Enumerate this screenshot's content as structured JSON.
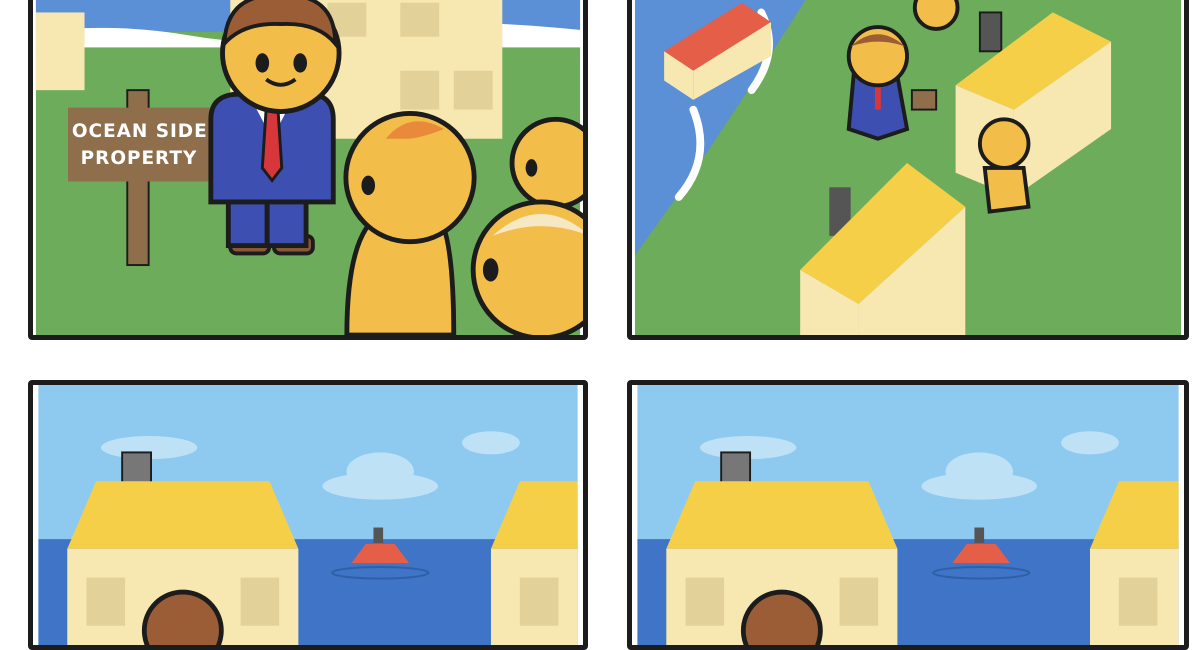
{
  "comic": {
    "sign": {
      "line1": "OCEAN SIDE",
      "line2": "PROPERTY"
    }
  },
  "colors": {
    "outline": "#1c1c1c",
    "sky": "#8ec9ef",
    "ocean": "#3f74c6",
    "grass": "#6cac5a",
    "skin": "#f3bd4a",
    "roof": "#f6cf49",
    "wall": "#f7e7b0",
    "suit": "#3d4fb0",
    "tie": "#d7373a",
    "hair": "#9b5d35",
    "sign": "#8f6e4c",
    "boat": "#e55e47"
  }
}
